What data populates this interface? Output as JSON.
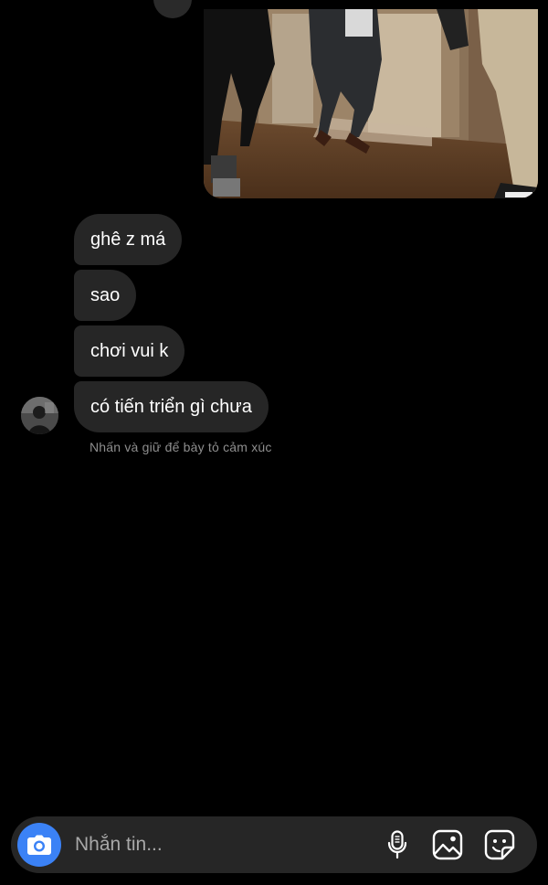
{
  "messages": [
    {
      "text": "ghê z má"
    },
    {
      "text": "sao"
    },
    {
      "text": "chơi vui k"
    },
    {
      "text": "có tiến triển gì chưa"
    }
  ],
  "reaction_hint": "Nhấn và giữ để bày tỏ cảm xúc",
  "composer": {
    "placeholder": "Nhắn tin...",
    "accent_color": "#3b82f6"
  },
  "icons": {
    "camera": "camera-icon",
    "mic": "microphone-icon",
    "gallery": "image-icon",
    "sticker": "sticker-icon"
  },
  "colors": {
    "background": "#000000",
    "bubble": "#262626",
    "hint_text": "#8e8e8e"
  }
}
